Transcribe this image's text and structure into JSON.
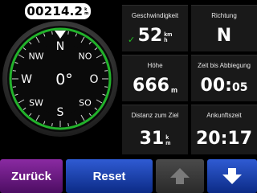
{
  "odometer": {
    "value": "00214.2",
    "unit_top": "k",
    "unit_bottom": "m"
  },
  "compass": {
    "heading": "0°",
    "cardinals": {
      "n": "N",
      "s": "S",
      "e": "O",
      "w": "W"
    },
    "intercardinals": {
      "nw": "NW",
      "no": "NO",
      "sw": "SW",
      "so": "SO"
    },
    "ring_color": "#22b22b"
  },
  "fields": {
    "speed": {
      "label": "Geschwindigkeit",
      "value": "52",
      "unit_top": "km",
      "unit_bottom": "h"
    },
    "direction": {
      "label": "Richtung",
      "value": "N"
    },
    "altitude": {
      "label": "Höhe",
      "value": "666",
      "unit": "m"
    },
    "time_to_turn": {
      "label": "Zeit bis Abbiegung",
      "value_main": "00:",
      "value_small": "05"
    },
    "distance_to_dest": {
      "label": "Distanz zum Ziel",
      "value": "31",
      "unit_top": "k",
      "unit_bottom": "m"
    },
    "arrival_time": {
      "label": "Ankunftszeit",
      "value": "20:17"
    }
  },
  "buttons": {
    "back": "Zurück",
    "reset": "Reset",
    "up_icon": "arrow-up-icon",
    "down_icon": "arrow-down-icon"
  }
}
